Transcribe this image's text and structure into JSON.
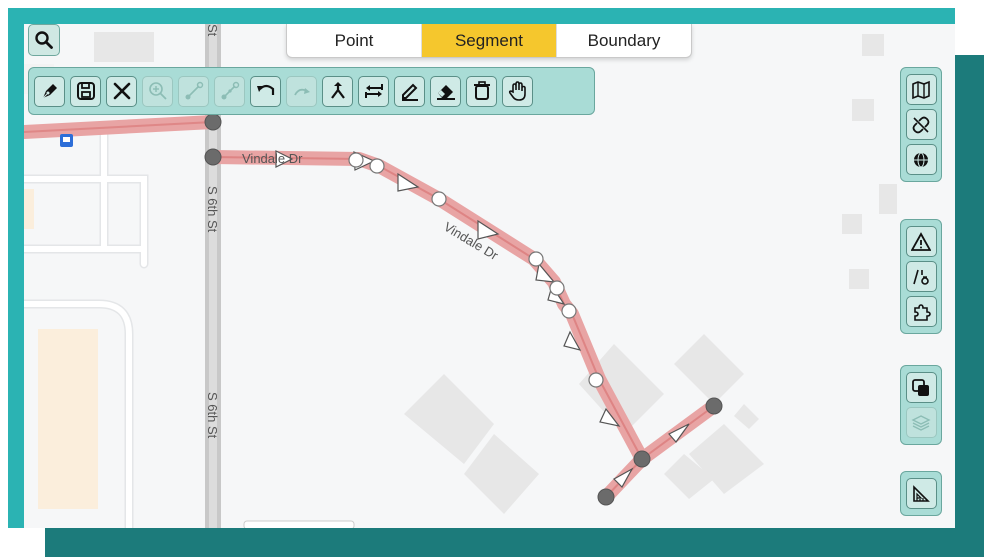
{
  "mode_tabs": [
    {
      "label": "Point",
      "active": false
    },
    {
      "label": "Segment",
      "active": true
    },
    {
      "label": "Boundary",
      "active": false
    }
  ],
  "map": {
    "street_labels": {
      "top_partial": "St",
      "s6th_upper": "S 6th St",
      "s6th_lower": "S 6th St",
      "vindale_upper": "Vindale Dr",
      "vindale_lower": "Vindale Dr"
    }
  },
  "toolbar": {
    "buttons": [
      {
        "name": "draw-icon",
        "enabled": true
      },
      {
        "name": "save-icon",
        "enabled": true
      },
      {
        "name": "cancel-icon",
        "enabled": true
      },
      {
        "name": "zoom-to-selection-icon",
        "enabled": false
      },
      {
        "name": "connect-nodes-icon",
        "enabled": false
      },
      {
        "name": "split-segment-icon",
        "enabled": false
      },
      {
        "name": "undo-icon",
        "enabled": true
      },
      {
        "name": "redo-icon",
        "enabled": false
      },
      {
        "name": "merge-icon",
        "enabled": true
      },
      {
        "name": "reverse-direction-icon",
        "enabled": true
      },
      {
        "name": "edit-attributes-icon",
        "enabled": true
      },
      {
        "name": "erase-icon",
        "enabled": true
      },
      {
        "name": "delete-icon",
        "enabled": true
      },
      {
        "name": "pan-hand-icon",
        "enabled": true
      }
    ]
  },
  "right_rail": {
    "groups": [
      [
        "map-icon",
        "unlink-icon",
        "globe-icon"
      ],
      [
        "warning-icon",
        "road-restriction-icon",
        "puzzle-icon"
      ],
      [
        "overlap-icon",
        "layers-icon"
      ],
      [
        "measure-icon"
      ]
    ]
  },
  "colors": {
    "accent_teal": "#2bb3b3",
    "dark_teal": "#1c7b7b",
    "active_tab": "#f5c72d",
    "segment_highlight": "#e8a4a4",
    "node_dark": "#666666"
  }
}
